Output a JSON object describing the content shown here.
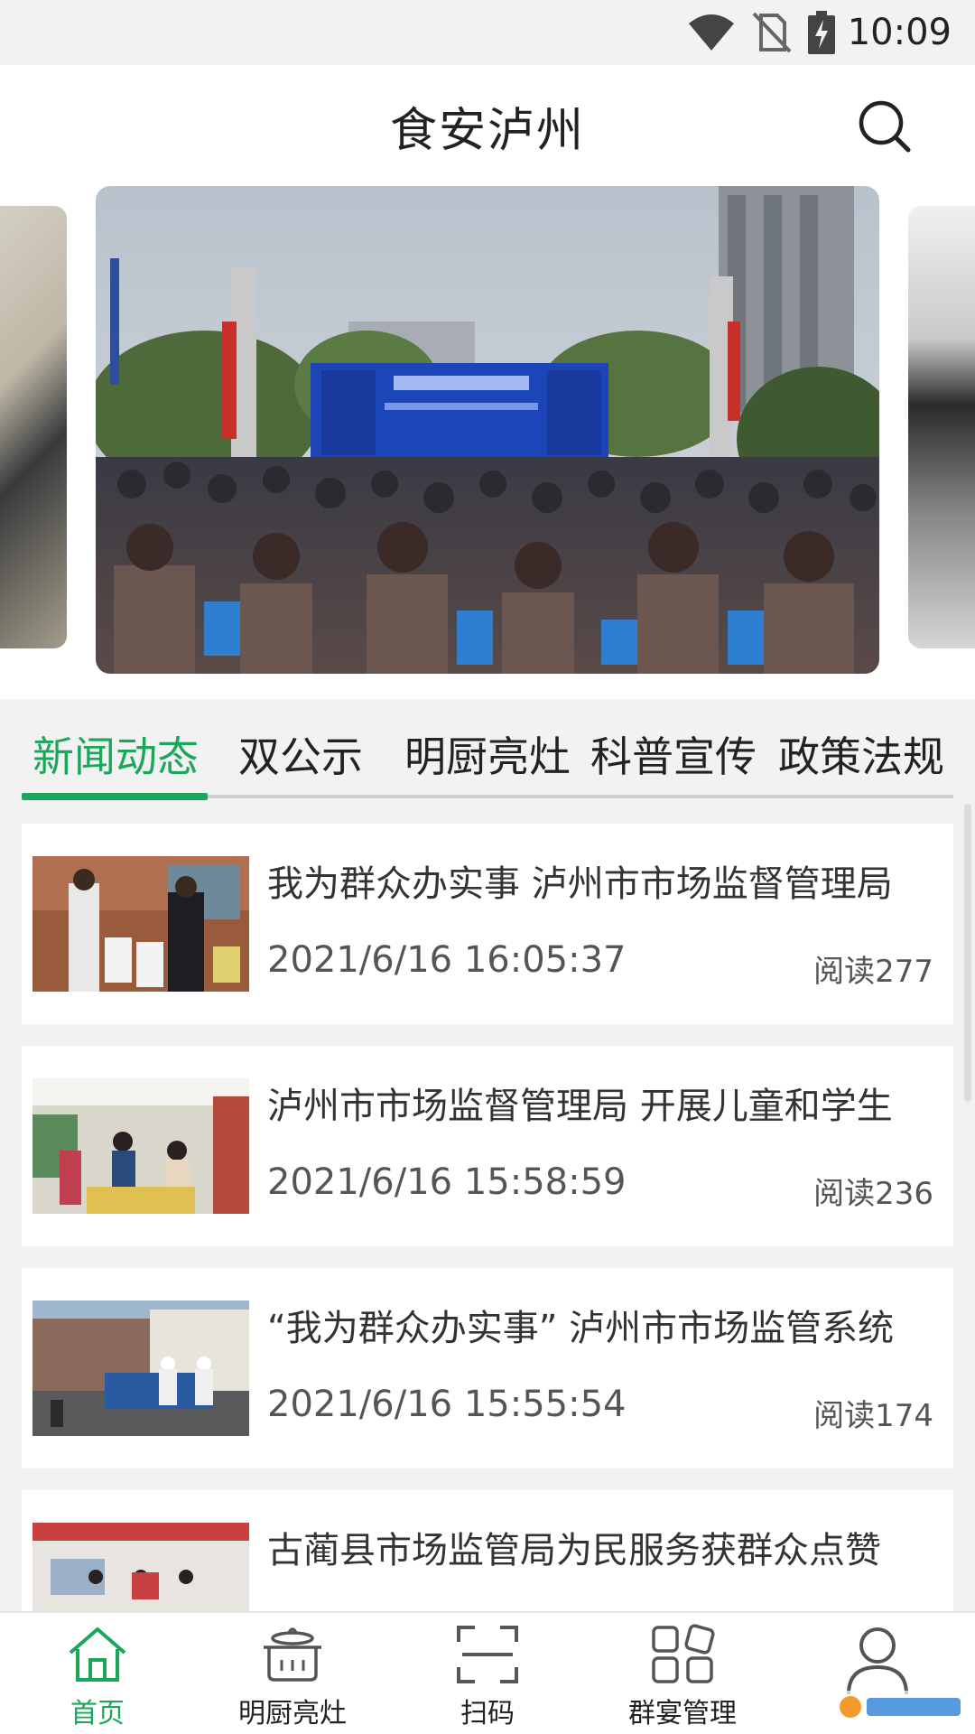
{
  "status_bar": {
    "time": "10:09",
    "icons": [
      "wifi-icon",
      "no-sim-icon",
      "battery-charging-icon"
    ]
  },
  "header": {
    "title": "食安泸州",
    "search_icon": "search-icon"
  },
  "tabs": [
    {
      "label": "新闻动态",
      "active": true
    },
    {
      "label": "双公示",
      "active": false
    },
    {
      "label": "明厨亮灶",
      "active": false
    },
    {
      "label": "科普宣传",
      "active": false
    },
    {
      "label": "政策法规",
      "active": false
    }
  ],
  "news": [
    {
      "title": "我为群众办实事 泸州市市场监督管理局",
      "date": "2021/6/16 16:05:37",
      "reads": "阅读277"
    },
    {
      "title": "泸州市市场监督管理局 开展儿童和学生",
      "date": "2021/6/16 15:58:59",
      "reads": "阅读236"
    },
    {
      "title": "“我为群众办实事” 泸州市市场监管系统",
      "date": "2021/6/16 15:55:54",
      "reads": "阅读174"
    },
    {
      "title": "古蔺县市场监管局为民服务获群众点赞",
      "date": "",
      "reads": ""
    }
  ],
  "bottom_nav": [
    {
      "label": "首页",
      "icon": "home-icon",
      "active": true
    },
    {
      "label": "明厨亮灶",
      "icon": "kitchen-pot-icon",
      "active": false
    },
    {
      "label": "扫码",
      "icon": "scan-icon",
      "active": false
    },
    {
      "label": "群宴管理",
      "icon": "grid-apps-icon",
      "active": false
    },
    {
      "label": "",
      "icon": "user-icon",
      "active": false
    }
  ],
  "colors": {
    "accent": "#1aa75a",
    "background": "#f2f2f2",
    "card": "#ffffff"
  }
}
